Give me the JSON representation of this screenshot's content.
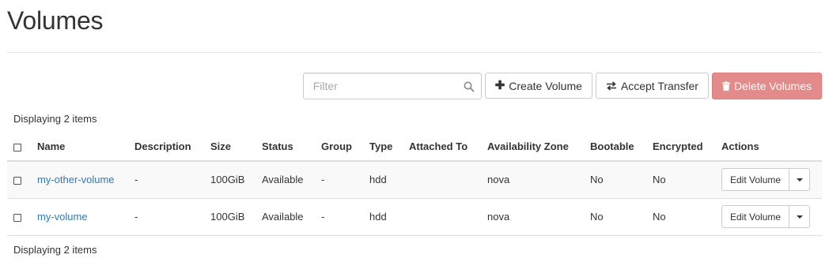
{
  "page": {
    "title": "Volumes"
  },
  "toolbar": {
    "filter_placeholder": "Filter",
    "create_label": "Create Volume",
    "accept_label": "Accept Transfer",
    "delete_label": "Delete Volumes"
  },
  "table": {
    "count_text": "Displaying 2 items",
    "headers": {
      "name": "Name",
      "description": "Description",
      "size": "Size",
      "status": "Status",
      "group": "Group",
      "type": "Type",
      "attached": "Attached To",
      "zone": "Availability Zone",
      "bootable": "Bootable",
      "encrypted": "Encrypted",
      "actions": "Actions"
    },
    "rows": [
      {
        "name": "my-other-volume",
        "description": "-",
        "size": "100GiB",
        "status": "Available",
        "group": "-",
        "type": "hdd",
        "attached": "",
        "zone": "nova",
        "bootable": "No",
        "encrypted": "No",
        "action": "Edit Volume"
      },
      {
        "name": "my-volume",
        "description": "-",
        "size": "100GiB",
        "status": "Available",
        "group": "-",
        "type": "hdd",
        "attached": "",
        "zone": "nova",
        "bootable": "No",
        "encrypted": "No",
        "action": "Edit Volume"
      }
    ]
  },
  "icons": {
    "search": "search-icon",
    "create": "plus-icon",
    "accept": "transfer-arrows-icon",
    "delete": "trash-icon",
    "caret": "caret-down-icon"
  },
  "colors": {
    "link": "#337ab7",
    "danger": "#e38a8a"
  }
}
